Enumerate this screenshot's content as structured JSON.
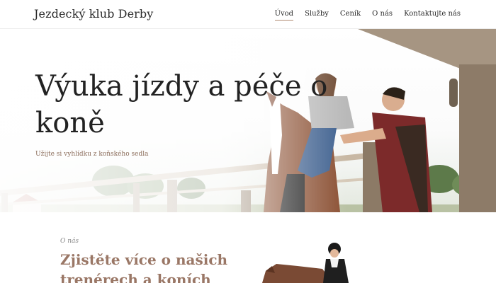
{
  "header": {
    "brand": "Jezdecký klub Derby",
    "nav": [
      {
        "label": "Úvod",
        "active": true
      },
      {
        "label": "Služby",
        "active": false
      },
      {
        "label": "Ceník",
        "active": false
      },
      {
        "label": "O nás",
        "active": false
      },
      {
        "label": "Kontaktujte nás",
        "active": false
      }
    ]
  },
  "hero": {
    "title": "Výuka jízdy a péče o koně",
    "subtitle": "Užijte si vyhlídku z koňského sedla"
  },
  "about": {
    "label": "O nás",
    "title": "Zjistěte více o našich trenérech a koních"
  },
  "colors": {
    "accent": "#b08a72",
    "about_title": "#9a7766",
    "subtitle": "#8c6e5c"
  }
}
